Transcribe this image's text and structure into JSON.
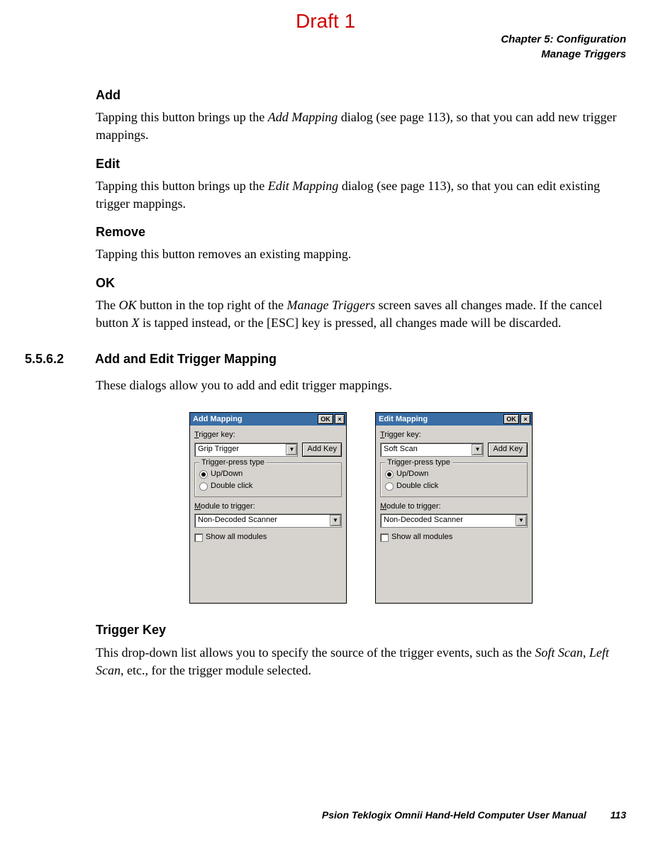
{
  "draft": "Draft 1",
  "chapter": {
    "line1": "Chapter 5: Configuration",
    "line2": "Manage Triggers"
  },
  "sections": {
    "add": {
      "heading": "Add",
      "text_pre": "Tapping this button brings up the ",
      "text_em": "Add Mapping",
      "text_post": " dialog (see page 113), so that you can add new trigger mappings."
    },
    "edit": {
      "heading": "Edit",
      "text_pre": "Tapping this button brings up the ",
      "text_em": "Edit Mapping",
      "text_post": " dialog (see page 113), so that you can edit existing trigger mappings."
    },
    "remove": {
      "heading": "Remove",
      "text": "Tapping this button removes an existing mapping."
    },
    "ok": {
      "heading": "OK",
      "text_pre": "The ",
      "text_em1": "OK",
      "text_mid1": " button in the top right of the ",
      "text_em2": "Manage Triggers",
      "text_mid2": " screen saves all changes made. If the cancel button ",
      "text_em3": "X",
      "text_post": " is tapped instead, or the [ESC] key is pressed, all changes made will be discarded."
    }
  },
  "subsection": {
    "number": "5.5.6.2",
    "title": "Add and Edit Trigger Mapping",
    "intro": "These dialogs allow you to add and edit trigger mappings."
  },
  "dialogs": {
    "shared": {
      "ok_btn": "OK",
      "close": "×",
      "trigger_key_label_u": "T",
      "trigger_key_label_rest": "rigger key:",
      "add_key_btn": "Add Key",
      "group_legend": "Trigger-press type",
      "radio1_u": "U",
      "radio1_rest": "p/Down",
      "radio2_u": "D",
      "radio2_rest": "ouble click",
      "module_label_u": "M",
      "module_label_rest": "odule to trigger:",
      "module_value": "Non-Decoded Scanner",
      "show_all_u": "S",
      "show_all_rest": "how all modules"
    },
    "add": {
      "title": "Add Mapping",
      "trigger_value": "Grip Trigger"
    },
    "edit": {
      "title": "Edit Mapping",
      "trigger_value": "Soft Scan"
    }
  },
  "trigger_key_section": {
    "heading": "Trigger Key",
    "text_pre": "This drop-down list allows you to specify the source of the trigger events, such as the ",
    "text_em1": "Soft Scan",
    "text_mid": ", ",
    "text_em2": "Left Scan",
    "text_post": ", etc., for the trigger module selected."
  },
  "footer": {
    "text": "Psion Teklogix Omnii Hand-Held Computer User Manual",
    "page": "113"
  }
}
